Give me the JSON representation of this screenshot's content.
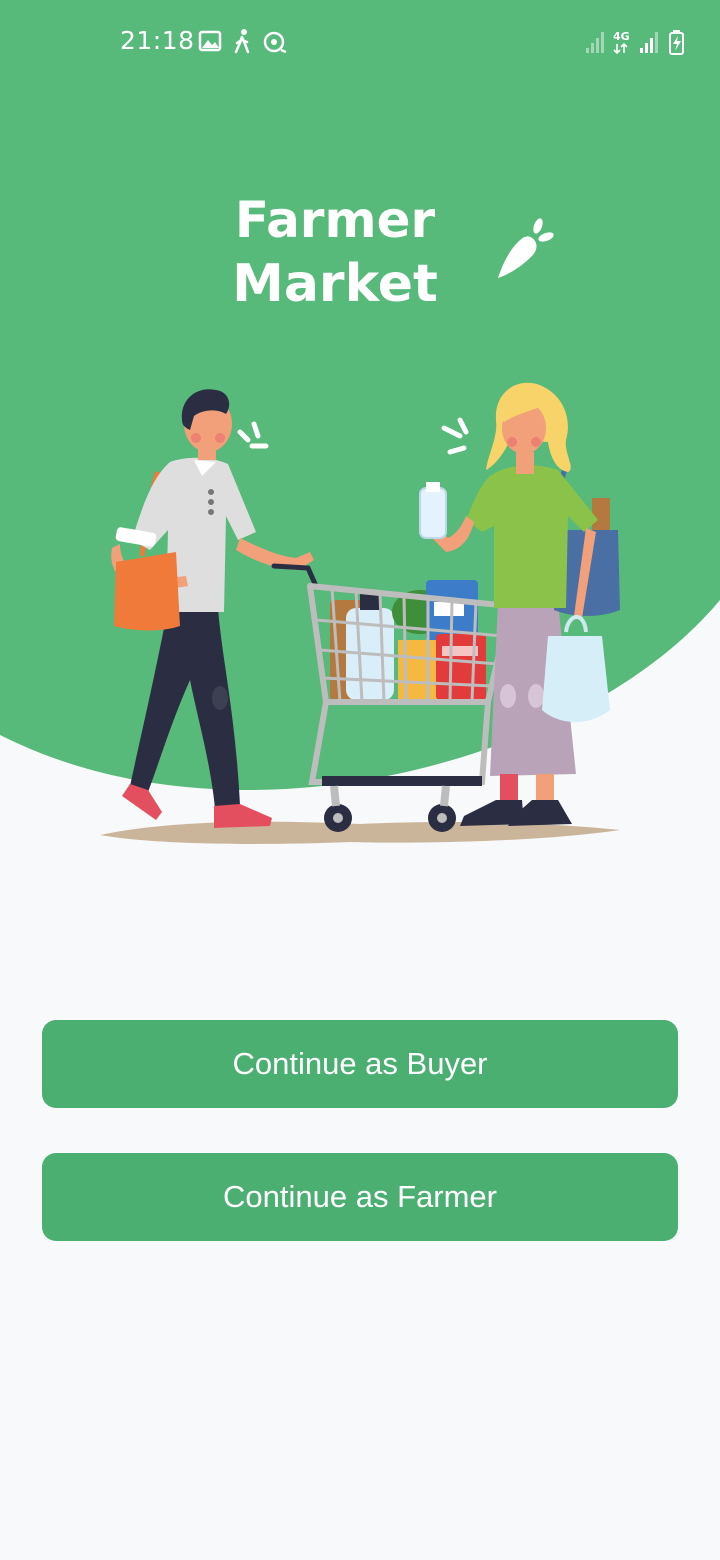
{
  "status_bar": {
    "time": "21:18",
    "left_icons": [
      "image-icon",
      "walking-person-icon",
      "sync-icon"
    ],
    "right_icons": [
      "signal-weak-icon",
      "network-4g-icon",
      "signal-icon",
      "battery-charging-icon"
    ],
    "network_label": "4G"
  },
  "hero": {
    "title_line1": "Farmer",
    "title_line2": "Market",
    "logo_icon": "carrot-icon",
    "illustration": "shoppers-with-cart-illustration"
  },
  "actions": {
    "buyer_label": "Continue as Buyer",
    "farmer_label": "Continue as Farmer"
  },
  "colors": {
    "brand_green": "#57b97a",
    "button_green": "#4caf72",
    "background": "#f8f9fa"
  }
}
